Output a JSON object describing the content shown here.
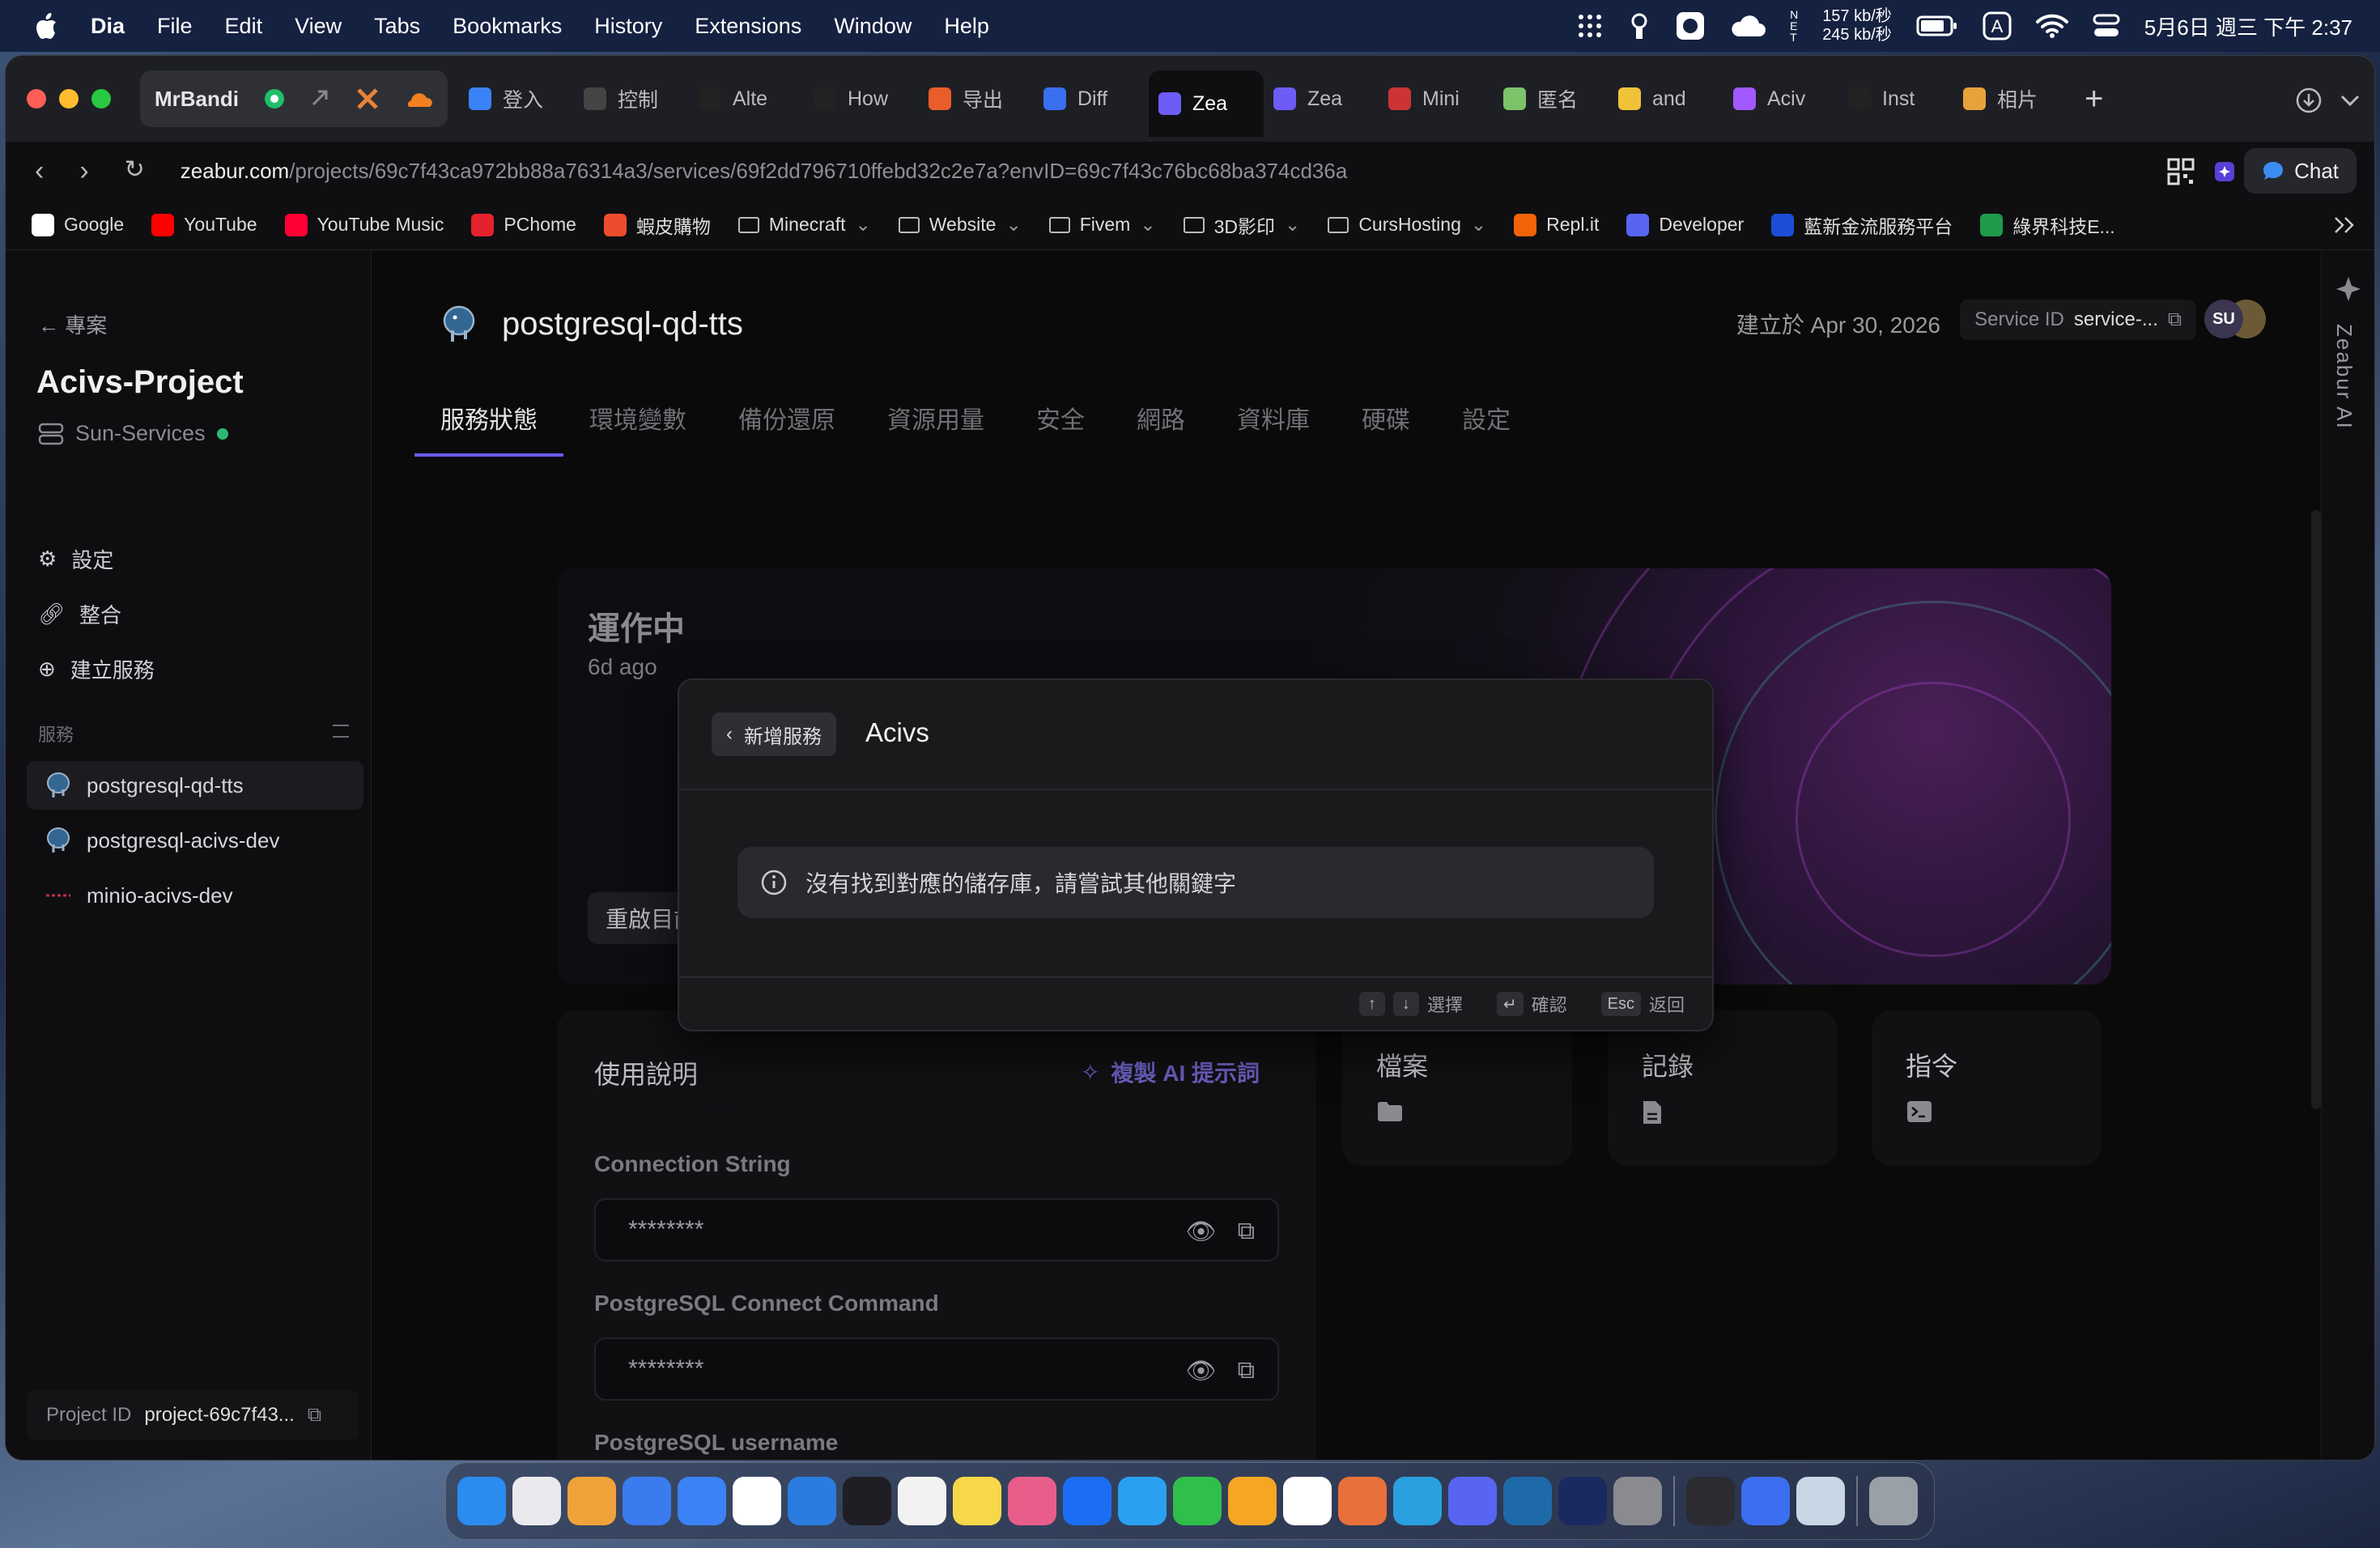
{
  "menubar": {
    "app": "Dia",
    "items": [
      "File",
      "Edit",
      "View",
      "Tabs",
      "Bookmarks",
      "History",
      "Extensions",
      "Window",
      "Help"
    ],
    "net_up": "157 kb/秒",
    "net_down": "245 kb/秒",
    "datetime": "5月6日 週三 下午 2:37"
  },
  "tabs": {
    "pinned_label": "MrBandi",
    "items": [
      {
        "label": "登入",
        "color": "#3b82f6"
      },
      {
        "label": "控制",
        "color": "#444"
      },
      {
        "label": "Alte",
        "color": "#222"
      },
      {
        "label": "How",
        "color": "#222"
      },
      {
        "label": "导出",
        "color": "#e85d2a"
      },
      {
        "label": "Diff",
        "color": "#3a6ff0"
      },
      {
        "label": "Zea",
        "color": "#6d5cf5",
        "active": true
      },
      {
        "label": "Zea",
        "color": "#6d5cf5"
      },
      {
        "label": "Mini",
        "color": "#c33"
      },
      {
        "label": "匿名",
        "color": "#7cc36a"
      },
      {
        "label": "and",
        "color": "#f0c23a"
      },
      {
        "label": "Aciv",
        "color": "#a259ff"
      },
      {
        "label": "Inst",
        "color": "#222"
      },
      {
        "label": "相片",
        "color": "#e8a23a"
      }
    ]
  },
  "address": {
    "host": "zeabur.com",
    "path": "/projects/69c7f43ca972bb88a76314a3/services/69f2dd796710ffebd32c2e7a?envID=69c7f43c76bc68ba374cd36a",
    "chat": "Chat"
  },
  "bookmarks": [
    {
      "label": "Google",
      "color": "#fff"
    },
    {
      "label": "YouTube",
      "color": "#ff0000"
    },
    {
      "label": "YouTube Music",
      "color": "#ff0033"
    },
    {
      "label": "PChome",
      "color": "#e4222e"
    },
    {
      "label": "蝦皮購物",
      "color": "#ee4d2d"
    },
    {
      "label": "Minecraft",
      "folder": true
    },
    {
      "label": "Website",
      "folder": true
    },
    {
      "label": "Fivem",
      "folder": true
    },
    {
      "label": "3D影印",
      "folder": true
    },
    {
      "label": "CursHosting",
      "folder": true
    },
    {
      "label": "Repl.it",
      "color": "#f26207"
    },
    {
      "label": "Developer",
      "color": "#5865f2"
    },
    {
      "label": "藍新金流服務平台",
      "color": "#1d4ed8"
    },
    {
      "label": "綠界科技E...",
      "color": "#1e9b4b"
    }
  ],
  "sidebar": {
    "back": "專案",
    "project": "Acivs-Project",
    "env": "Sun-Services",
    "links": [
      "設定",
      "整合",
      "建立服務"
    ],
    "services_label": "服務",
    "services": [
      "postgresql-qd-tts",
      "postgresql-acivs-dev",
      "minio-acivs-dev"
    ],
    "project_id_label": "Project ID",
    "project_id": "project-69c7f43..."
  },
  "service": {
    "name": "postgresql-qd-tts",
    "created": "建立於 Apr 30, 2026",
    "service_id_label": "Service ID",
    "service_id": "service-...",
    "avatar": "SU",
    "tabs": [
      "服務狀態",
      "環境變數",
      "備份還原",
      "資源用量",
      "安全",
      "網路",
      "資料庫",
      "硬碟",
      "設定"
    ],
    "status": "運作中",
    "ago": "6d ago",
    "restart": "重啟目前版本"
  },
  "usage": {
    "title": "使用說明",
    "copy_ai": "複製 AI 提示詞",
    "fields": [
      {
        "label": "Connection String",
        "value": "********"
      },
      {
        "label": "PostgreSQL Connect Command",
        "value": "********"
      },
      {
        "label": "PostgreSQL username",
        "value": "********"
      }
    ]
  },
  "minis": [
    "檔案",
    "記錄",
    "指令"
  ],
  "zeabur_ai": "Zeabur AI",
  "modal": {
    "back": "新增服務",
    "query": "Acivs",
    "notice": "沒有找到對應的儲存庫，請嘗試其他關鍵字",
    "select": "選擇",
    "confirm": "確認",
    "esc": "Esc",
    "back_hint": "返回"
  }
}
